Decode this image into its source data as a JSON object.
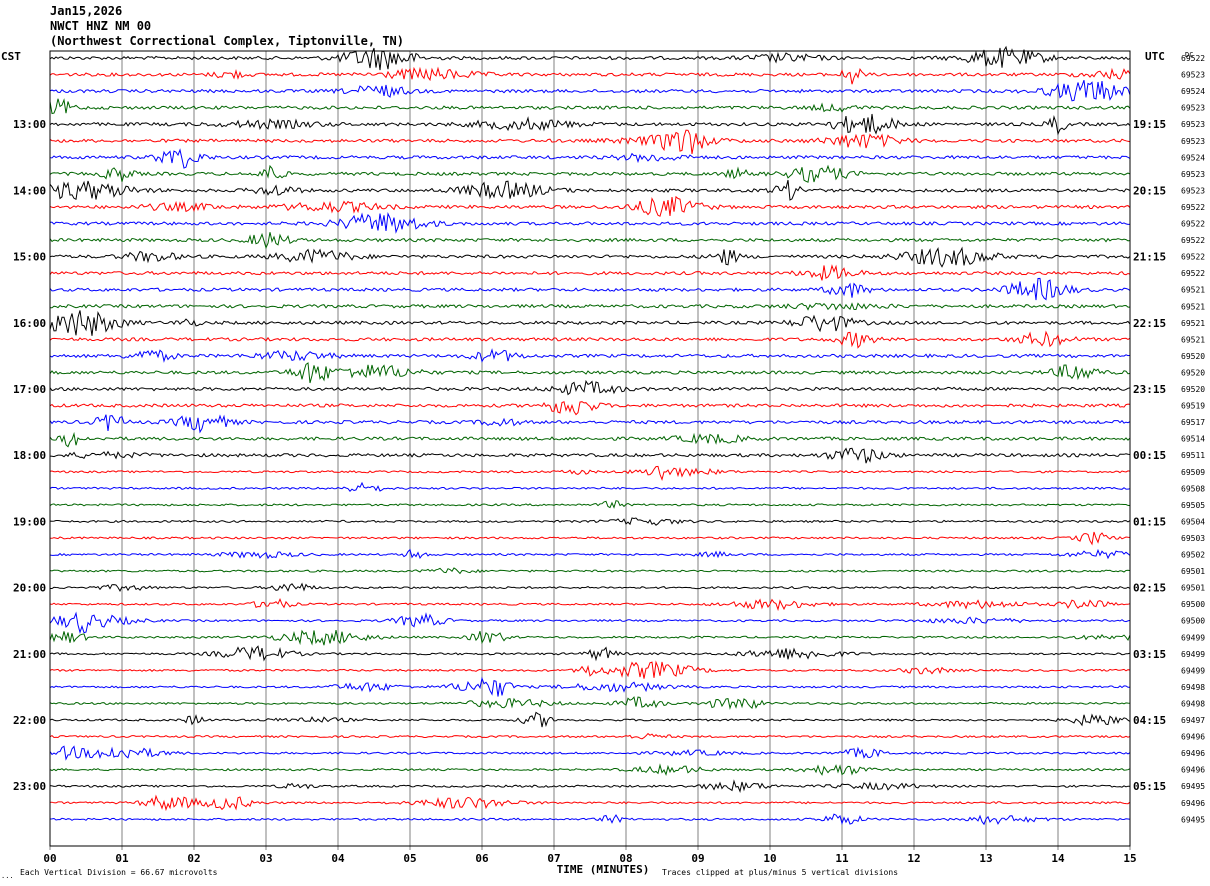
{
  "header": {
    "date": "Jan15,2026",
    "station": "NWCT HNZ NM 00",
    "location": "(Northwest Correctional Complex, Tiptonville, TN)"
  },
  "chart_data": {
    "type": "line",
    "title": "NWCT HNZ NM 00",
    "left_axis_label": "CST",
    "right_axis_label": "UTC",
    "dc_label": "DC",
    "xlabel": "TIME (MINUTES)",
    "xlim": [
      0,
      15
    ],
    "x_ticks": [
      "00",
      "01",
      "02",
      "03",
      "04",
      "05",
      "06",
      "07",
      "08",
      "09",
      "10",
      "11",
      "12",
      "13",
      "14",
      "15"
    ],
    "left_hour_labels": [
      "13:00",
      "14:00",
      "15:00",
      "16:00",
      "17:00",
      "18:00",
      "19:00",
      "20:00",
      "21:00",
      "22:00",
      "23:00"
    ],
    "right_hour_labels": [
      "19:15",
      "20:15",
      "21:15",
      "22:15",
      "23:15",
      "00:15",
      "01:15",
      "02:15",
      "03:15",
      "04:15",
      "05:15"
    ],
    "trace_colors": [
      "#000000",
      "#ff0000",
      "#0000ff",
      "#006400"
    ],
    "dc_offsets": [
      "69522",
      "69523",
      "69524",
      "69523",
      "69523",
      "69523",
      "69524",
      "69523",
      "69523",
      "69522",
      "69522",
      "69522",
      "69522",
      "69522",
      "69521",
      "69521",
      "69521",
      "69521",
      "69520",
      "69520",
      "69520",
      "69519",
      "69517",
      "69514",
      "69511",
      "69509",
      "69508",
      "69505",
      "69504",
      "69503",
      "69502",
      "69501",
      "69501",
      "69500",
      "69500",
      "69499",
      "69499",
      "69499",
      "69498",
      "69498",
      "69497",
      "69496",
      "69496",
      "69496",
      "69495",
      "69496",
      "69495"
    ],
    "footer_left": "Each Vertical Division =   66.67 microvolts",
    "footer_right": "Traces clipped at plus/minus 5 vertical divisions",
    "corner_mark": "..."
  }
}
